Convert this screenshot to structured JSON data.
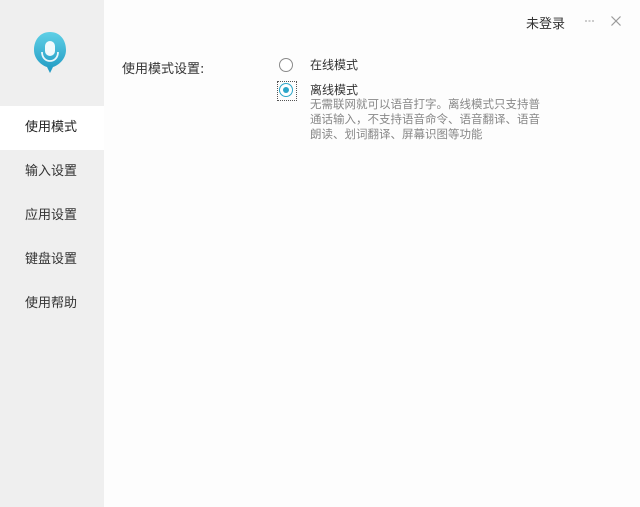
{
  "header": {
    "login_label": "未登录",
    "minimize_icon": "minimize-icon",
    "close_icon": "close-icon"
  },
  "logo": {
    "icon": "mic-bubble-logo-icon",
    "color": "#2aa6c9"
  },
  "sidebar": {
    "items": [
      {
        "label": "使用模式",
        "active": true
      },
      {
        "label": "输入设置",
        "active": false
      },
      {
        "label": "应用设置",
        "active": false
      },
      {
        "label": "键盘设置",
        "active": false
      },
      {
        "label": "使用帮助",
        "active": false
      }
    ]
  },
  "main": {
    "section_label": "使用模式设置:",
    "options": [
      {
        "label": "在线模式",
        "checked": false
      },
      {
        "label": "离线模式",
        "checked": true,
        "description": "无需联网就可以语音打字。离线模式只支持普通话输入，不支持语音命令、语音翻译、语音朗读、划词翻译、屏幕识图等功能"
      }
    ]
  },
  "colors": {
    "accent": "#2aa6c9",
    "sidebar_bg": "#efefef",
    "content_bg": "#fdfdfd"
  }
}
